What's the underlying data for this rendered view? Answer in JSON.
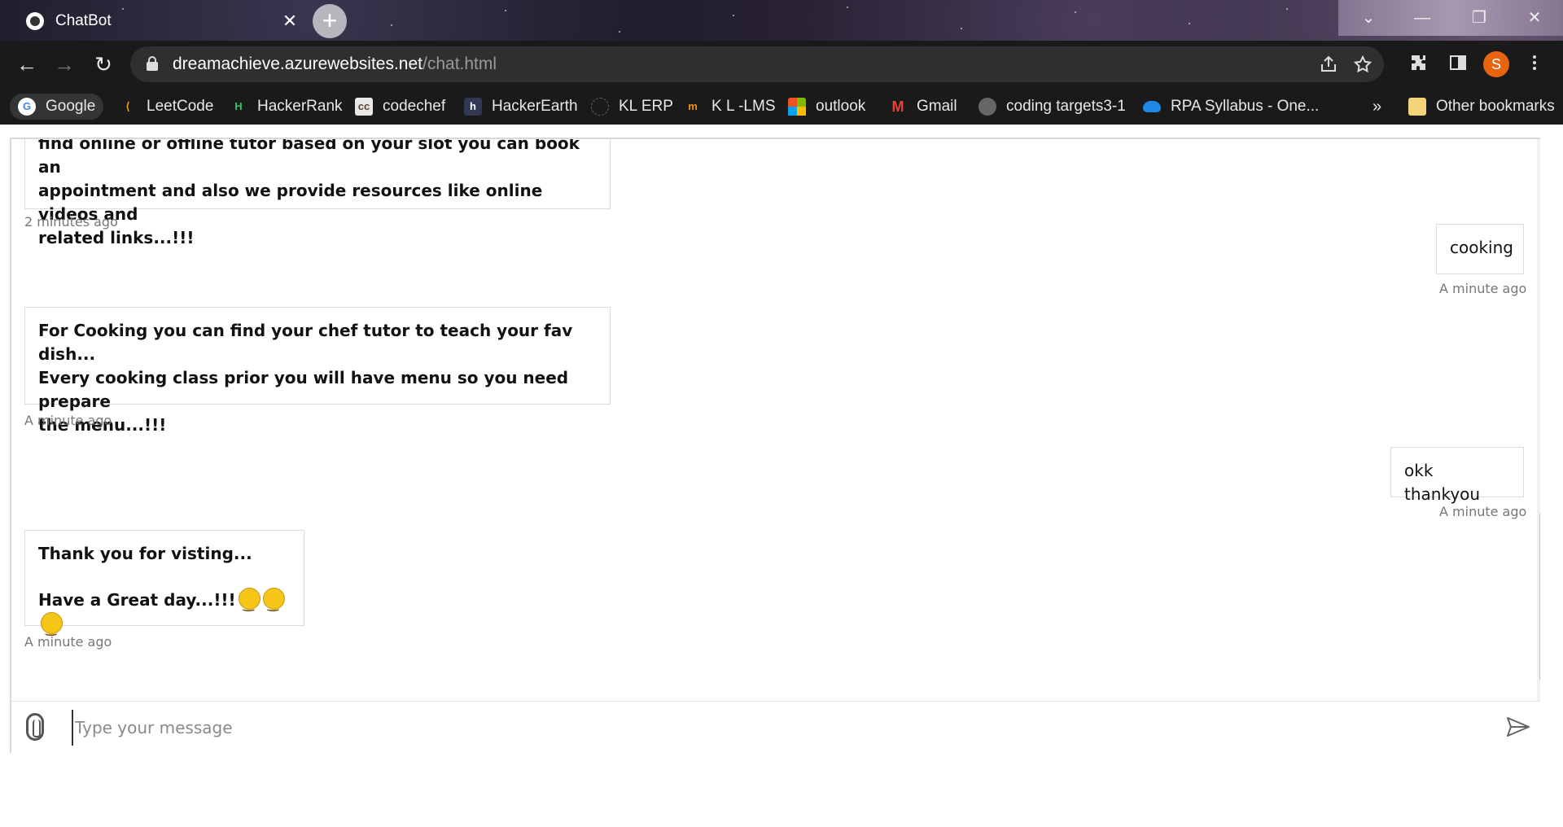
{
  "tab": {
    "title": "ChatBot",
    "close": "✕",
    "new_tab": "+"
  },
  "window_controls": {
    "dropdown": "⌄",
    "minimize": "—",
    "restore": "❐",
    "close": "✕"
  },
  "nav": {
    "back": "←",
    "forward": "→",
    "reload": "↻"
  },
  "address": {
    "host": "dreamachieve.azurewebsites.net",
    "path": "/chat.html"
  },
  "avatar_letter": "S",
  "bookmarks": {
    "items": [
      {
        "label": "Google"
      },
      {
        "label": "LeetCode"
      },
      {
        "label": "HackerRank"
      },
      {
        "label": "codechef"
      },
      {
        "label": "HackerEarth"
      },
      {
        "label": "KL ERP"
      },
      {
        "label": "K L -LMS"
      },
      {
        "label": "outlook"
      },
      {
        "label": "Gmail"
      },
      {
        "label": "coding targets3-1"
      },
      {
        "label": "RPA Syllabus - One..."
      }
    ],
    "overflow": "»",
    "other": "Other bookmarks"
  },
  "chat": {
    "messages": [
      {
        "from": "bot",
        "lines": [
          "find online or offline tutor based on your slot you can book an",
          "appointment and also we provide resources like online videos and",
          "related links...!!!"
        ],
        "time": "2 minutes ago"
      },
      {
        "from": "user",
        "text": "cooking",
        "time": "A minute ago"
      },
      {
        "from": "bot",
        "lines": [
          "For Cooking you can find your chef tutor to teach your fav dish...",
          "Every cooking class prior you will have menu so you need prepare",
          "the menu...!!!"
        ],
        "time": "A minute ago"
      },
      {
        "from": "user",
        "text": "okk thankyou",
        "time": "A minute ago"
      },
      {
        "from": "bot",
        "lines": [
          "Thank you for visting...",
          "Have a Great day...!!!"
        ],
        "time": "A minute ago"
      }
    ],
    "input_placeholder": "Type your message"
  }
}
